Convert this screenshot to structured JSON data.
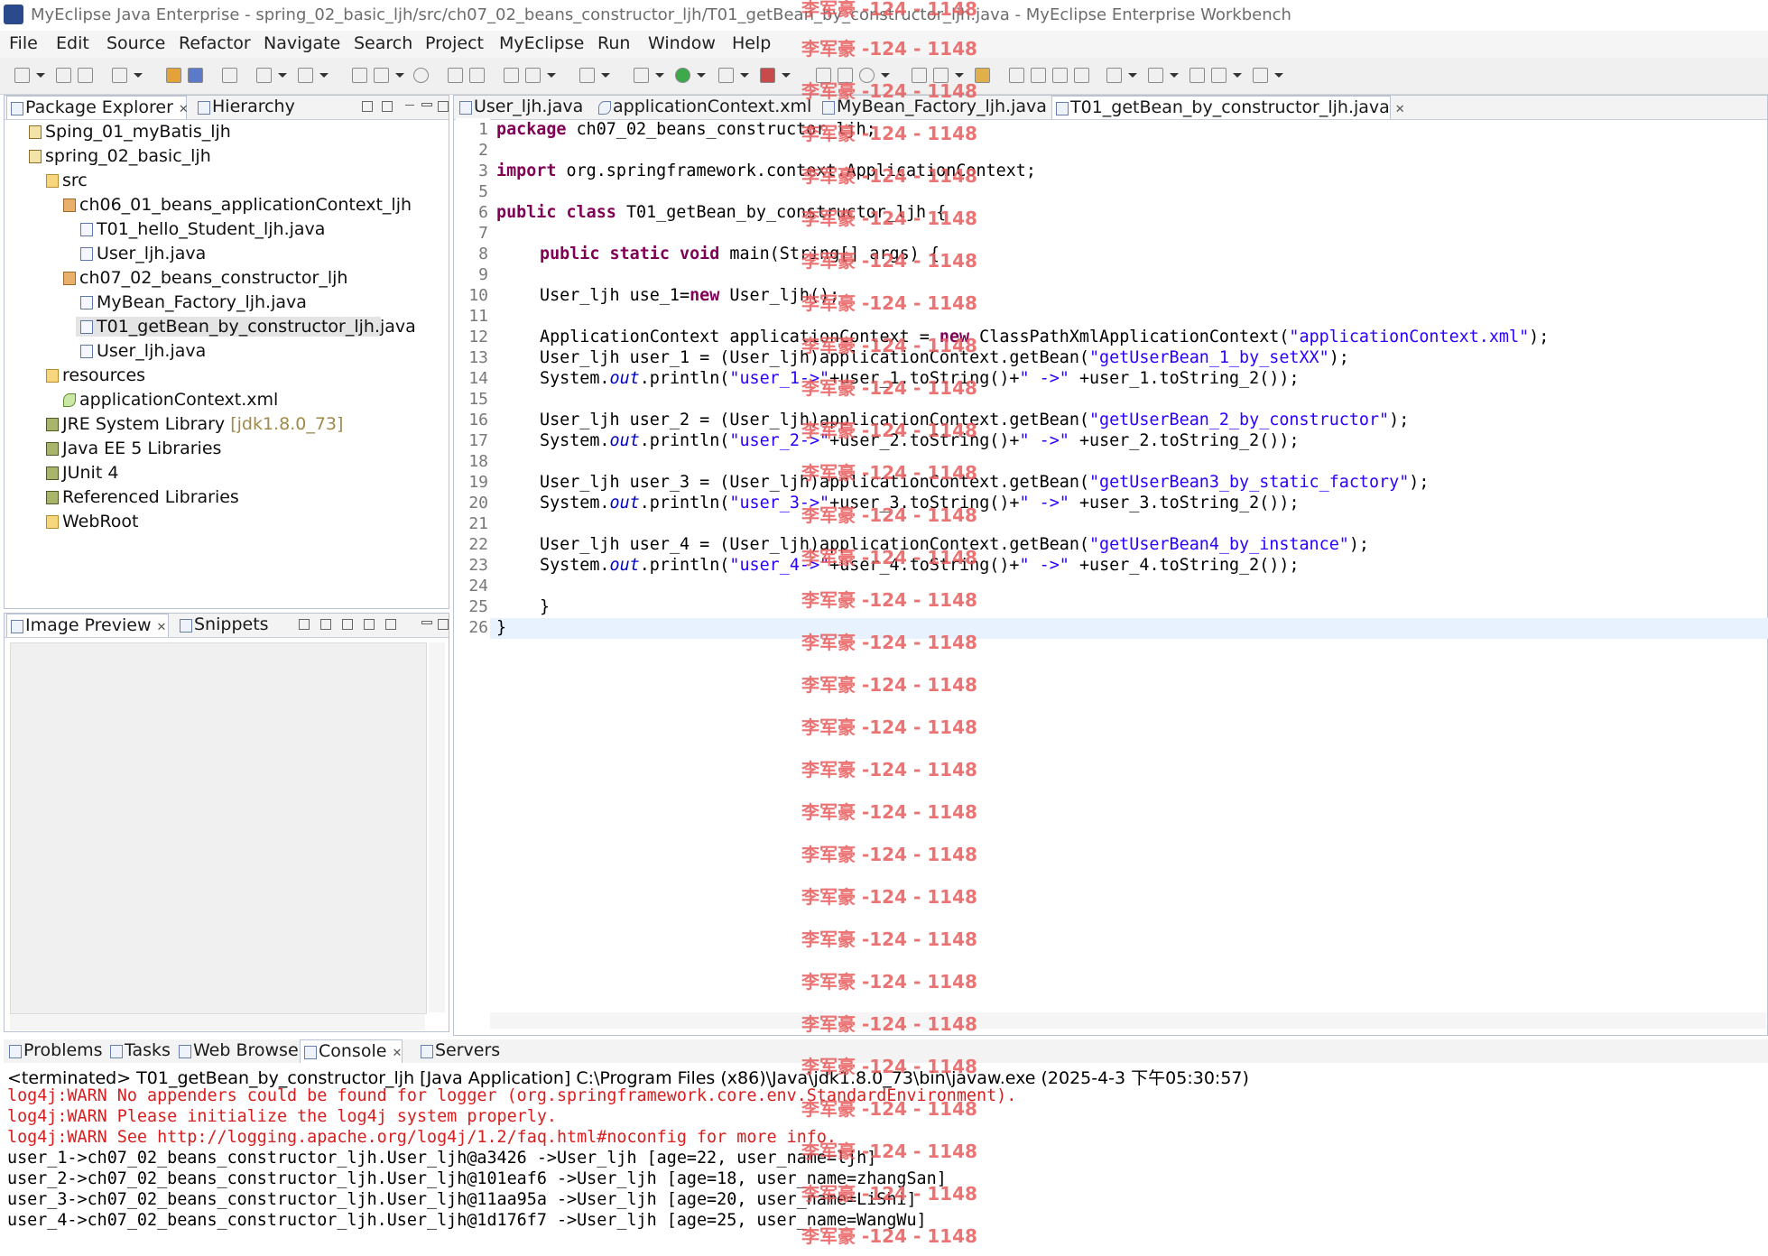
{
  "window": {
    "title": "MyEclipse Java Enterprise - spring_02_basic_ljh/src/ch07_02_beans_constructor_ljh/T01_getBean_by_constructor_ljh.java - MyEclipse Enterprise Workbench"
  },
  "menu": [
    "File",
    "Edit",
    "Source",
    "Refactor",
    "Navigate",
    "Search",
    "Project",
    "MyEclipse",
    "Run",
    "Window",
    "Help"
  ],
  "explorer": {
    "tabs": [
      "Package Explorer",
      "Hierarchy"
    ],
    "items": [
      {
        "label": "Sping_01_myBatis_ljh"
      },
      {
        "label": "spring_02_basic_ljh"
      },
      {
        "label": "src"
      },
      {
        "label": "ch06_01_beans_applicationContext_ljh"
      },
      {
        "label": "T01_hello_Student_ljh.java"
      },
      {
        "label": "User_ljh.java"
      },
      {
        "label": "ch07_02_beans_constructor_ljh"
      },
      {
        "label": "MyBean_Factory_ljh.java"
      },
      {
        "label": "T01_getBean_by_constructor_ljh.java"
      },
      {
        "label": "User_ljh.java"
      },
      {
        "label": "resources"
      },
      {
        "label": "applicationContext.xml"
      },
      {
        "label": "JRE System Library ",
        "extra": "[jdk1.8.0_73]"
      },
      {
        "label": "Java EE 5 Libraries"
      },
      {
        "label": "JUnit 4"
      },
      {
        "label": "Referenced Libraries"
      },
      {
        "label": "WebRoot"
      }
    ]
  },
  "preview": {
    "tabs": [
      "Image Preview",
      "Snippets"
    ]
  },
  "editor": {
    "tabs": [
      "User_ljh.java",
      "applicationContext.xml",
      "MyBean_Factory_ljh.java",
      "T01_getBean_by_constructor_ljh.java"
    ],
    "line_numbers": [
      "1",
      "2",
      "3",
      "5",
      "6",
      "7",
      "8",
      "9",
      "10",
      "11",
      "12",
      "13",
      "14",
      "15",
      "16",
      "17",
      "18",
      "19",
      "20",
      "21",
      "22",
      "23",
      "24",
      "25",
      "26"
    ],
    "code": {
      "l1_kw": "package",
      "l1": " ch07_02_beans_constructor_ljh;",
      "l3_kw": "import",
      "l3": " org.springframework.context.ApplicationContext;",
      "l6_kw": "public class",
      "l6": " T01_getBean_by_constructor_ljh {",
      "l8_kw": "public static void",
      "l8": " main(String[] args) {",
      "l10a": "User_ljh use_1=",
      "l10_kw": "new",
      "l10b": " User_ljh();",
      "l12a": "ApplicationContext applicationContext = ",
      "l12_kw": "new",
      "l12b": " ClassPathXmlApplicationContext(",
      "l12_str": "\"applicationContext.xml\"",
      "l12c": ");",
      "l13a": "User_ljh user_1 = (User_ljh)applicationContext.getBean(",
      "l13_str": "\"getUserBean_1_by_setXX\"",
      "l13b": ");",
      "l14a": "System.",
      "l14_it": "out",
      "l14b": ".println(",
      "l14_s1": "\"user_1->\"",
      "l14c": "+user_1.toString()+",
      "l14_s2": "\" ->\"",
      "l14d": " +user_1.toString_2());",
      "l16a": "User_ljh user_2 = (User_ljh)applicationContext.getBean(",
      "l16_str": "\"getUserBean_2_by_constructor\"",
      "l16b": ");",
      "l17a": "System.",
      "l17_it": "out",
      "l17b": ".println(",
      "l17_s1": "\"user_2->\"",
      "l17c": "+user_2.toString()+",
      "l17_s2": "\" ->\"",
      "l17d": " +user_2.toString_2());",
      "l19a": "User_ljh user_3 = (User_ljh)applicationContext.getBean(",
      "l19_str": "\"getUserBean3_by_static_factory\"",
      "l19b": ");",
      "l20a": "System.",
      "l20_it": "out",
      "l20b": ".println(",
      "l20_s1": "\"user_3->\"",
      "l20c": "+user_3.toString()+",
      "l20_s2": "\" ->\"",
      "l20d": " +user_3.toString_2());",
      "l22a": "User_ljh user_4 = (User_ljh)applicationContext.getBean(",
      "l22_str": "\"getUserBean4_by_instance\"",
      "l22b": ");",
      "l23a": "System.",
      "l23_it": "out",
      "l23b": ".println(",
      "l23_s1": "\"user_4->\"",
      "l23c": "+user_4.toString()+",
      "l23_s2": "\" ->\"",
      "l23d": " +user_4.toString_2());",
      "l25": "}",
      "l26": "}"
    }
  },
  "bottom": {
    "tabs": [
      "Problems",
      "Tasks",
      "Web Browser",
      "Console",
      "Servers"
    ],
    "console_header": "<terminated> T01_getBean_by_constructor_ljh [Java Application] C:\\Program Files (x86)\\Java\\jdk1.8.0_73\\bin\\javaw.exe (2025-4-3 下午05:30:57)",
    "errors": [
      "log4j:WARN No appenders could be found for logger (org.springframework.core.env.StandardEnvironment).",
      "log4j:WARN Please initialize the log4j system properly.",
      "log4j:WARN See http://logging.apache.org/log4j/1.2/faq.html#noconfig for more info."
    ],
    "output": [
      "user_1->ch07_02_beans_constructor_ljh.User_ljh@a3426 ->User_ljh [age=22, user_name=ljh]",
      "user_2->ch07_02_beans_constructor_ljh.User_ljh@101eaf6 ->User_ljh [age=18, user_name=zhangSan]",
      "user_3->ch07_02_beans_constructor_ljh.User_ljh@11aa95a ->User_ljh [age=20, user_name=LiShi]",
      "user_4->ch07_02_beans_constructor_ljh.User_ljh@1d176f7 ->User_ljh [age=25, user_name=WangWu]"
    ]
  },
  "watermark": {
    "text": "李军豪 -124 - 1148"
  }
}
